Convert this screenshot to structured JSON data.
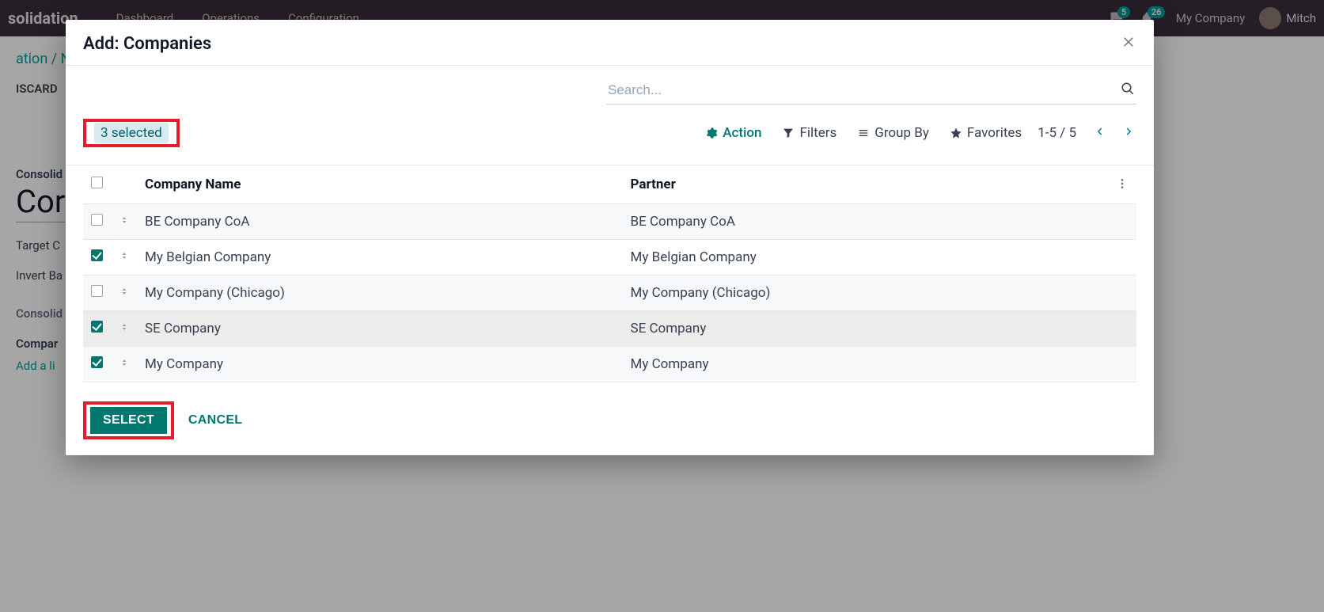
{
  "bg": {
    "brand": "solidation",
    "nav": [
      "Dashboard",
      "Operations",
      "Configuration"
    ],
    "badges": {
      "msg": "5",
      "activity": "26"
    },
    "company_label": "My Company",
    "user": "Mitch",
    "breadcrumb_root": "ation",
    "breadcrumb_sep": " / ",
    "breadcrumb_current": "N",
    "discard": "ISCARD",
    "label_consolidation": "Consolid",
    "big_field": "Cor",
    "label_target": "Target C",
    "label_invert": "Invert Ba",
    "section_consolid": "Consolid",
    "companies_header": "Compar",
    "add_a_line": "Add a li"
  },
  "modal": {
    "title": "Add: Companies",
    "search_placeholder": "Search...",
    "selected_badge": "3 selected",
    "action_label": "Action",
    "filters_label": "Filters",
    "groupby_label": "Group By",
    "favorites_label": "Favorites",
    "pager": "1-5 / 5",
    "columns": {
      "company": "Company Name",
      "partner": "Partner"
    },
    "rows": [
      {
        "checked": false,
        "company": "BE Company CoA",
        "partner": "BE Company CoA",
        "hovered": false
      },
      {
        "checked": true,
        "company": "My Belgian Company",
        "partner": "My Belgian Company",
        "hovered": false
      },
      {
        "checked": false,
        "company": "My Company (Chicago)",
        "partner": "My Company (Chicago)",
        "hovered": false
      },
      {
        "checked": true,
        "company": "SE Company",
        "partner": "SE Company",
        "hovered": true
      },
      {
        "checked": true,
        "company": "My Company",
        "partner": "My Company",
        "hovered": false
      }
    ],
    "select_button": "SELECT",
    "cancel_button": "CANCEL"
  }
}
